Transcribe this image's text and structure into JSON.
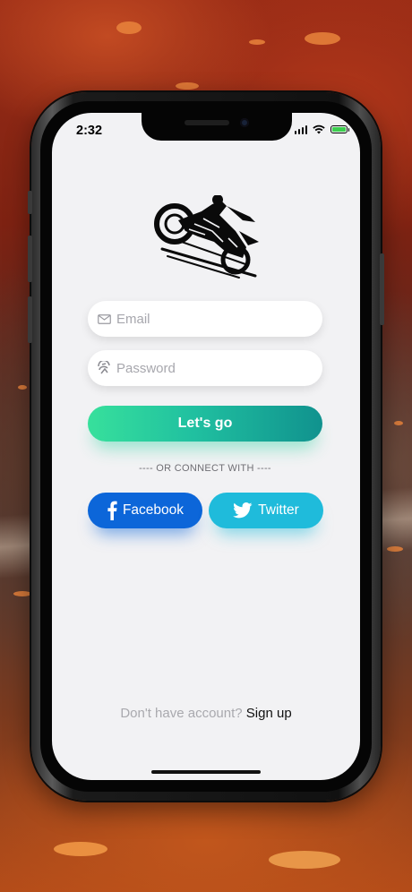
{
  "status_bar": {
    "time": "2:32"
  },
  "login_form": {
    "email_placeholder": "Email",
    "password_placeholder": "Password",
    "submit_label": "Let's go"
  },
  "social": {
    "divider_text": "---- OR CONNECT WITH ----",
    "facebook_label": "Facebook",
    "twitter_label": "Twitter"
  },
  "footer": {
    "question": "Don't have account?",
    "signup_label": "Sign up"
  },
  "colors": {
    "primary_gradient_start": "#37e09c",
    "primary_gradient_end": "#10928e",
    "facebook": "#0c66d9",
    "twitter": "#1fbbdb",
    "screen_bg": "#f2f2f4"
  },
  "icons": {
    "email": "envelope-icon",
    "password": "fingerprint-icon",
    "facebook": "facebook-f-icon",
    "twitter": "twitter-bird-icon",
    "logo": "motorcycle-rider-logo"
  }
}
